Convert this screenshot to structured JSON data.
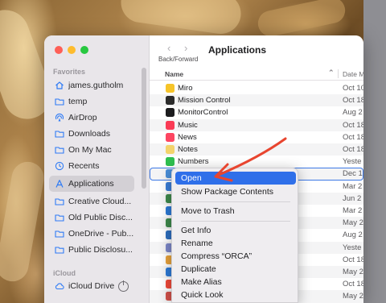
{
  "toolbar": {
    "back_forward_label": "Back/Forward",
    "title": "Applications"
  },
  "columns": {
    "name": "Name",
    "date": "Date M"
  },
  "sidebar": {
    "favorites_heading": "Favorites",
    "items": [
      {
        "label": "james.gutholm",
        "icon": "house-icon"
      },
      {
        "label": "temp",
        "icon": "folder-icon"
      },
      {
        "label": "AirDrop",
        "icon": "airdrop-icon"
      },
      {
        "label": "Downloads",
        "icon": "folder-icon"
      },
      {
        "label": "On My Mac",
        "icon": "folder-icon"
      },
      {
        "label": "Recents",
        "icon": "clock-icon"
      },
      {
        "label": "Applications",
        "icon": "applications-icon",
        "selected": true
      },
      {
        "label": "Creative Cloud...",
        "icon": "folder-icon"
      },
      {
        "label": "Old Public Disc...",
        "icon": "folder-icon"
      },
      {
        "label": "OneDrive - Pub...",
        "icon": "folder-icon"
      },
      {
        "label": "Public Disclosu...",
        "icon": "folder-icon"
      }
    ],
    "icloud_heading": "iCloud",
    "icloud_item": {
      "label": "iCloud Drive",
      "icon": "cloud-icon"
    }
  },
  "files": [
    {
      "name": "Miro",
      "date": "Oct 10",
      "color": "#f6c429"
    },
    {
      "name": "Mission Control",
      "date": "Oct 18",
      "color": "#2b2b2b"
    },
    {
      "name": "MonitorControl",
      "date": "Aug 2",
      "color": "#1c1c1e"
    },
    {
      "name": "Music",
      "date": "Oct 18",
      "color": "#fa3b55"
    },
    {
      "name": "News",
      "date": "Oct 18",
      "color": "#fd4561"
    },
    {
      "name": "Notes",
      "date": "Oct 18",
      "color": "#f3d36b"
    },
    {
      "name": "Numbers",
      "date": "Yeste",
      "color": "#2fbf4f"
    },
    {
      "name": "",
      "date": "Dec 1",
      "color": "#4a8fd9"
    },
    {
      "name": "",
      "date": "Mar 2",
      "color": "#3c7fd8"
    },
    {
      "name": "",
      "date": "Jun 2",
      "color": "#3e8a4c"
    },
    {
      "name": "",
      "date": "Mar 2",
      "color": "#2d7ad6"
    },
    {
      "name": "",
      "date": "May 2",
      "color": "#3e8a4c"
    },
    {
      "name": "",
      "date": "Aug 2",
      "color": "#2e6fbf"
    },
    {
      "name": "",
      "date": "Yeste",
      "color": "#7d88c9"
    },
    {
      "name": "",
      "date": "Oct 18",
      "color": "#e8a33c"
    },
    {
      "name": "",
      "date": "May 2",
      "color": "#2d7ad6"
    },
    {
      "name": "",
      "date": "Oct 18",
      "color": "#f04a3a"
    },
    {
      "name": "",
      "date": "May 2",
      "color": "#d2514a"
    },
    {
      "name": "",
      "date": "Oct 18",
      "color": "#b46ad9"
    }
  ],
  "context_menu": {
    "open": "Open",
    "show_package_contents": "Show Package Contents",
    "move_to_trash": "Move to Trash",
    "get_info": "Get Info",
    "rename": "Rename",
    "compress": "Compress “ORCA”",
    "duplicate": "Duplicate",
    "make_alias": "Make Alias",
    "quick_look": "Quick Look"
  },
  "colors": {
    "accent": "#2f6fe9",
    "annotation_arrow": "#e8452f"
  }
}
